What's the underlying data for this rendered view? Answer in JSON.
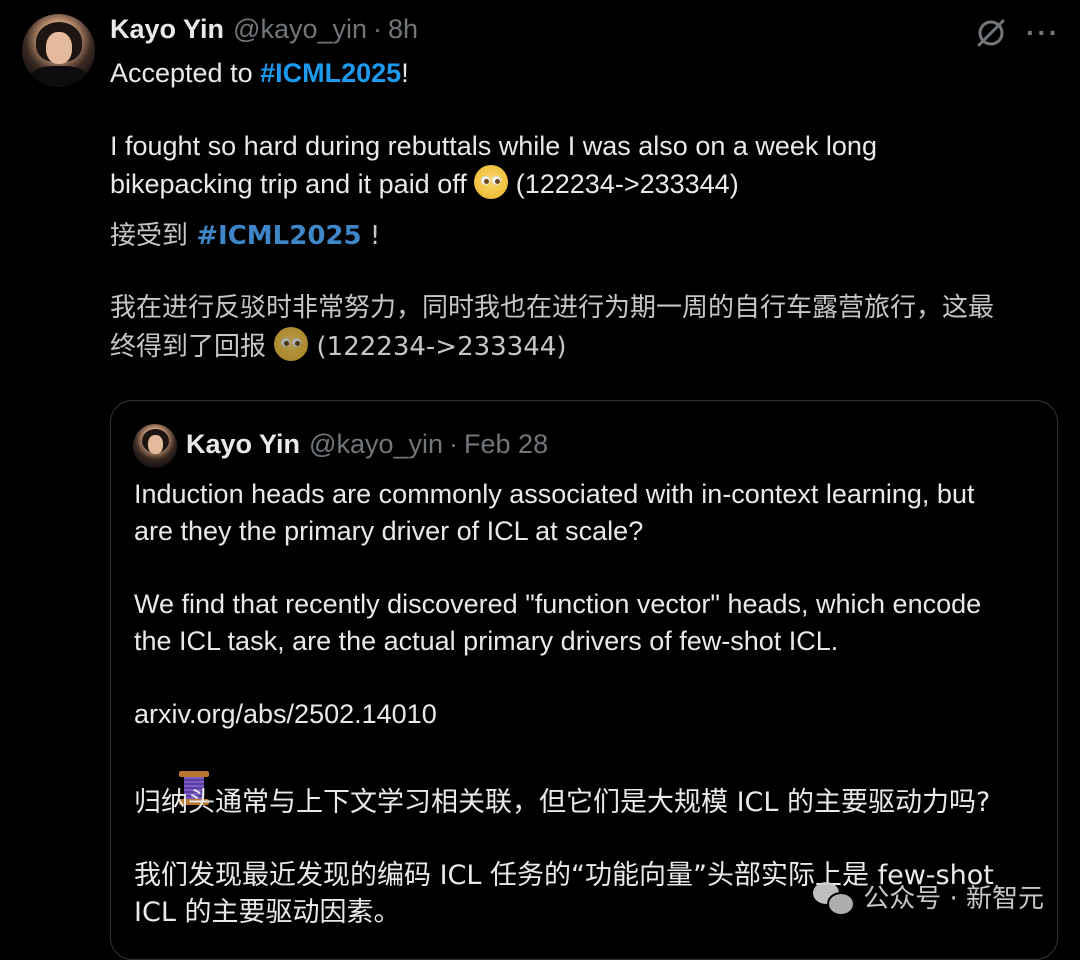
{
  "tweet": {
    "name": "Kayo Yin",
    "handle": "@kayo_yin",
    "separator": "·",
    "time": "8h",
    "line1_pre": "Accepted to ",
    "hashtag": "#ICML2025",
    "line1_post": "!",
    "para2": "I fought so hard during rebuttals while I was also on a week long\nbikepacking trip and it paid off ",
    "para2_tail": " (122234->233344)",
    "zh_line1_pre": "接受到 ",
    "zh_hashtag": "#ICML2025",
    "zh_line1_post": " !",
    "zh_para2": "我在进行反驳时非常努力，同时我也在进行为期一周的自行车露营旅行，这最\n终得到了回报 ",
    "zh_para2_tail": " (122234->233344)"
  },
  "icons": {
    "grok": "grok-icon",
    "more": "···",
    "more_name": "more-options-icon",
    "emoji": "pleading-face-emoji",
    "spool": "thread-spool-emoji"
  },
  "quote": {
    "name": "Kayo Yin",
    "handle": "@kayo_yin",
    "separator": "·",
    "time": "Feb 28",
    "para1": "Induction heads are commonly associated with in-context learning, but\nare they the primary driver of ICL at scale?",
    "para2": "We find that recently discovered \"function vector\" heads, which encode\nthe ICL task, are the actual primary drivers of few-shot ICL.",
    "link": "arxiv.org/abs/2502.14010",
    "zh_para1": "归纳头通常与上下文学习相关联，但它们是大规模 ICL 的主要驱动力吗?",
    "zh_para2": "我们发现最近发现的编码 ICL 任务的“功能向量”头部实际上是 few-shot\nICL 的主要驱动因素。"
  },
  "watermark": {
    "text": "公众号 · 新智元"
  },
  "colors": {
    "background": "#000000",
    "text": "#e7e9ea",
    "secondary": "#71767b",
    "accent": "#1d9bf0",
    "border": "#333639"
  }
}
